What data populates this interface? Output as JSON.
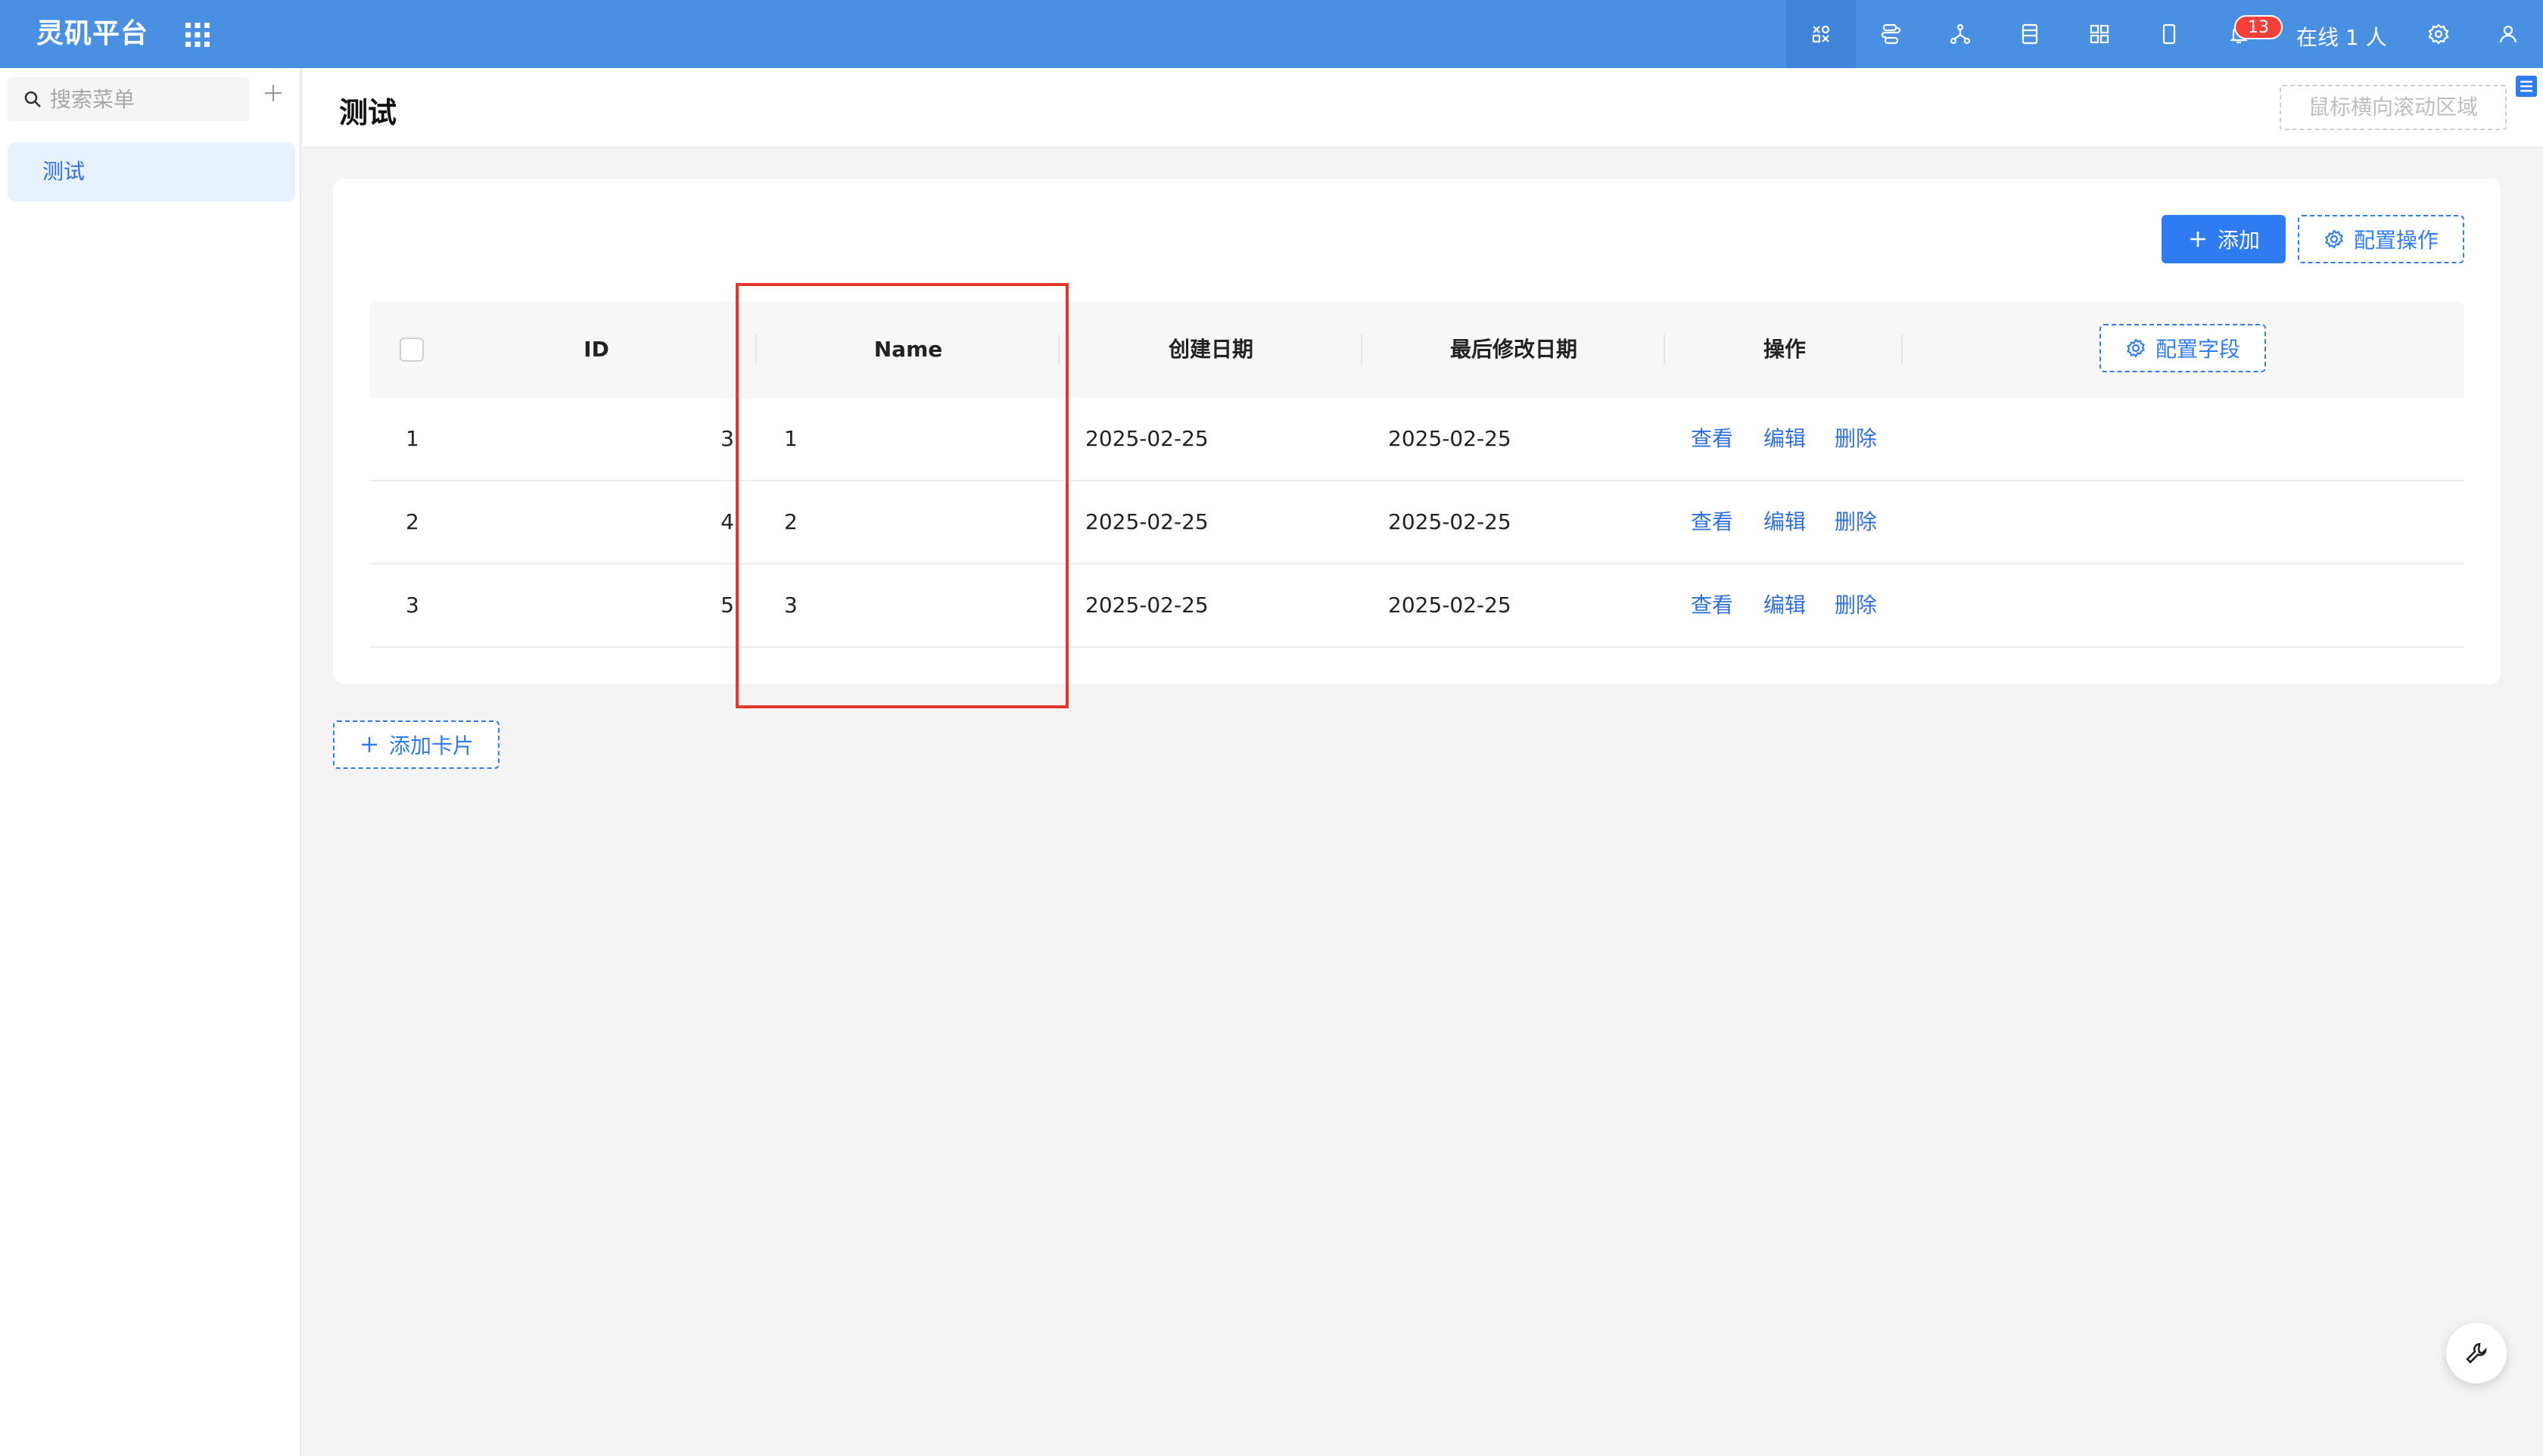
{
  "app": {
    "title": "灵矶平台",
    "notification_count": "13",
    "online_text": "在线 1 人"
  },
  "sidebar": {
    "search_placeholder": "搜索菜单",
    "items": [
      {
        "label": "测试"
      }
    ]
  },
  "page": {
    "title": "测试",
    "scroll_hint": "鼠标横向滚动区域"
  },
  "toolbar": {
    "add_label": "添加",
    "config_actions_label": "配置操作",
    "config_fields_label": "配置字段",
    "add_card_label": "添加卡片"
  },
  "table": {
    "columns": [
      "ID",
      "Name",
      "创建日期",
      "最后修改日期",
      "操作"
    ],
    "rows": [
      {
        "index": "1",
        "id": "3",
        "name": "1",
        "created": "2025-02-25",
        "modified": "2025-02-25"
      },
      {
        "index": "2",
        "id": "4",
        "name": "2",
        "created": "2025-02-25",
        "modified": "2025-02-25"
      },
      {
        "index": "3",
        "id": "5",
        "name": "3",
        "created": "2025-02-25",
        "modified": "2025-02-25"
      }
    ],
    "actions": {
      "view": "查看",
      "edit": "编辑",
      "delete": "删除"
    }
  },
  "colors": {
    "header_bg": "#4a90e2",
    "primary": "#2f7bf2",
    "highlight": "#e4362b"
  }
}
